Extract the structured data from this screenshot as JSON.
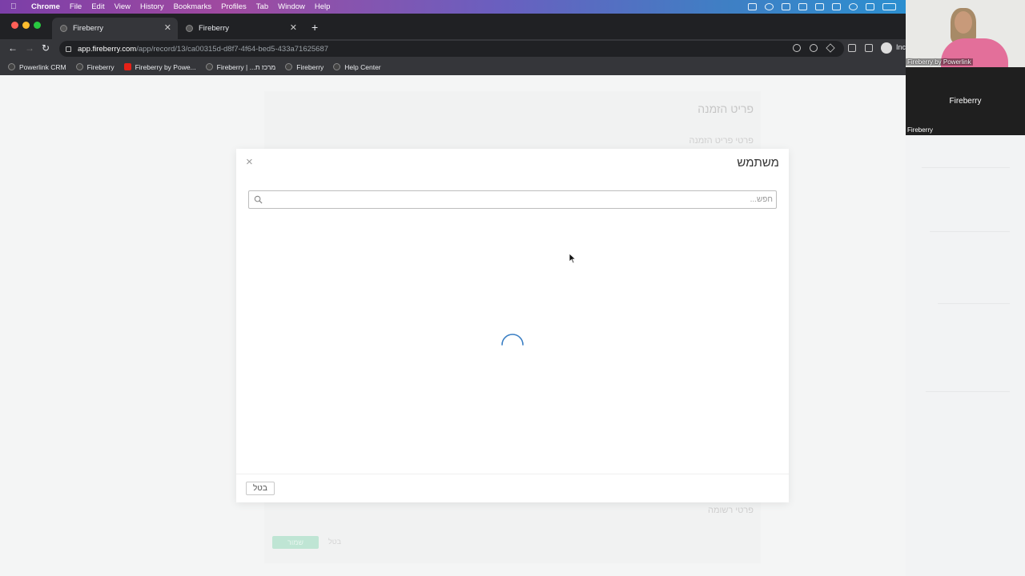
{
  "menubar": {
    "app_name": "Chrome",
    "items": [
      "File",
      "Edit",
      "View",
      "History",
      "Bookmarks",
      "Profiles",
      "Tab",
      "Window",
      "Help"
    ]
  },
  "browser": {
    "tabs": [
      {
        "title": "Fireberry",
        "active": true
      },
      {
        "title": "Fireberry",
        "active": false
      }
    ],
    "new_tab_label": "+",
    "url_host": "app.fireberry.com",
    "url_path": "/app/record/13/ca00315d-d8f7-4f64-bed5-433a71625687",
    "profile_label": "Inc",
    "bookmarks": [
      {
        "label": "Powerlink CRM",
        "icon": "fireberry-icon"
      },
      {
        "label": "Fireberry",
        "icon": "fireberry-icon"
      },
      {
        "label": "Fireberry by Powe...",
        "icon": "youtube-icon"
      },
      {
        "label": "Fireberry | ...מרכז ת",
        "icon": "fireberry-icon"
      },
      {
        "label": "Fireberry",
        "icon": "fireberry-icon"
      },
      {
        "label": "Help Center",
        "icon": "fireberry-icon"
      }
    ]
  },
  "background_form": {
    "title": "פריט הזמנה",
    "section1": "פרטי פריט הזמנה",
    "section2": "פרטי רשומה",
    "save_label": "שמור",
    "cancel_label": "בטל"
  },
  "modal": {
    "title": "משתמש",
    "close_symbol": "×",
    "search_placeholder": "חפש...",
    "search_value": "",
    "loading": true,
    "cancel_label": "בטל"
  },
  "video_call": {
    "participant1_name": "Fireberry by Powerlink",
    "participant2_center": "Fireberry",
    "participant2_name": "Fireberry"
  },
  "colors": {
    "accent": "#3b7fc4",
    "save_button": "#bfe5d4"
  }
}
